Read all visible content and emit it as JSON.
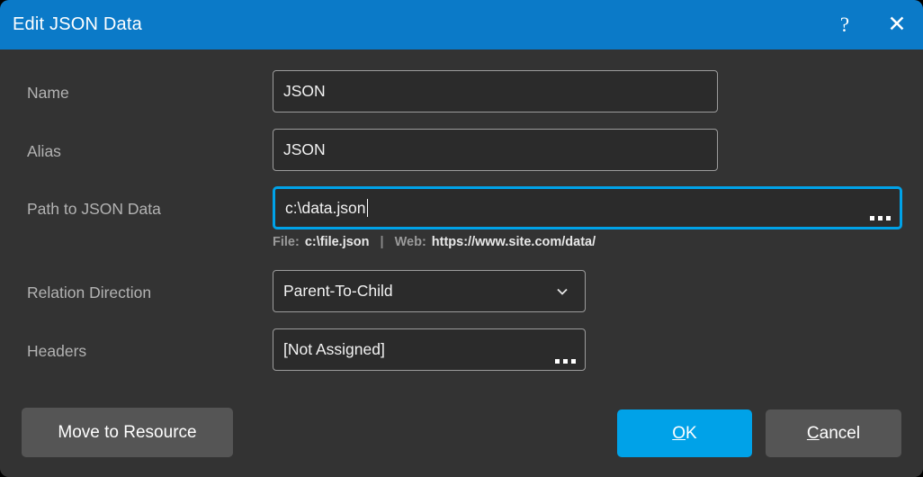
{
  "window": {
    "title": "Edit JSON Data",
    "help_icon": "question-mark-icon",
    "close_icon": "close-icon",
    "titlebar_color": "#0b7ac8",
    "background_color": "#333333",
    "accent_color": "#00a2e8"
  },
  "form": {
    "name": {
      "label": "Name",
      "value": "JSON"
    },
    "alias": {
      "label": "Alias",
      "value": "JSON"
    },
    "path": {
      "label": "Path to JSON Data",
      "value": "c:\\data.json",
      "browse_icon": "ellipsis-icon",
      "focused": true
    },
    "hint": {
      "file_label": "File:",
      "file_value": "c:\\file.json",
      "separator": "|",
      "web_label": "Web:",
      "web_value": "https://www.site.com/data/"
    },
    "relation_direction": {
      "label": "Relation Direction",
      "value": "Parent-To-Child",
      "dropdown_icon": "chevron-down-icon"
    },
    "headers": {
      "label": "Headers",
      "value": "[Not Assigned]",
      "browse_icon": "ellipsis-icon"
    }
  },
  "footer": {
    "move_to_resource": "Move to Resource",
    "ok_mnemonic": "O",
    "ok_rest": "K",
    "cancel_mnemonic": "C",
    "cancel_rest": "ancel"
  }
}
